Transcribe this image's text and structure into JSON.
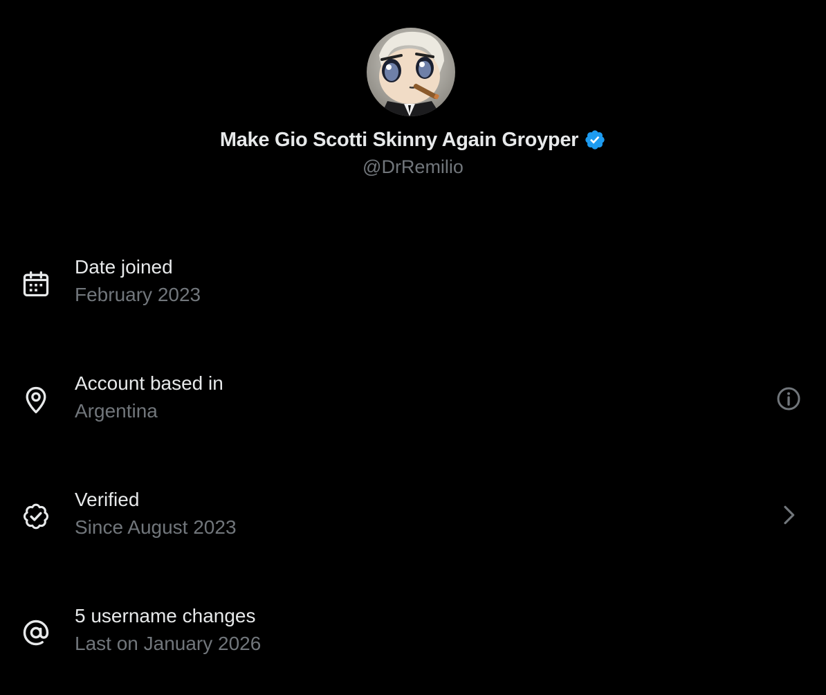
{
  "profile": {
    "display_name": "Make Gio Scotti Skinny Again Groyper",
    "handle": "@DrRemilio",
    "verified": true,
    "avatar": "anime-character-avatar"
  },
  "colors": {
    "background": "#000000",
    "primary_text": "#e7e9ea",
    "secondary_text": "#71767b",
    "verified_blue": "#1d9bf0"
  },
  "about": {
    "date_joined": {
      "icon": "calendar-icon",
      "title": "Date joined",
      "value": "February 2023"
    },
    "location": {
      "icon": "location-pin-icon",
      "title": "Account based in",
      "value": "Argentina",
      "trailing_icon": "info-icon"
    },
    "verified": {
      "icon": "verified-check-icon",
      "title": "Verified",
      "value": "Since August 2023",
      "trailing_icon": "chevron-right-icon"
    },
    "username_changes": {
      "icon": "at-sign-icon",
      "title": "5 username changes",
      "value": "Last on January 2026"
    }
  }
}
